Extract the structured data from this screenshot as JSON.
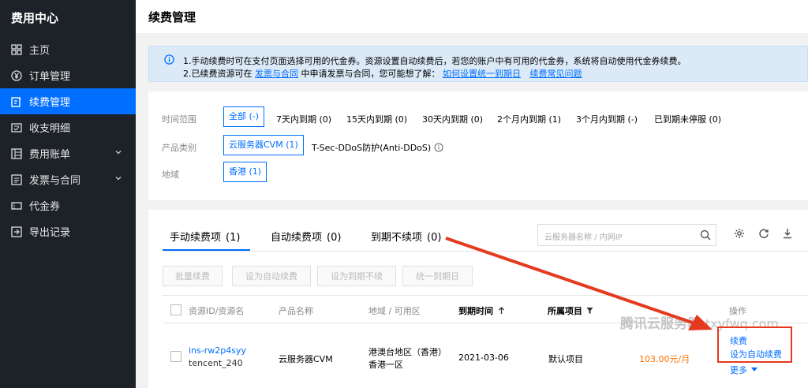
{
  "sidebar": {
    "title": "费用中心",
    "items": [
      {
        "label": "主页",
        "icon": "grid-icon"
      },
      {
        "label": "订单管理",
        "icon": "yuan-icon"
      },
      {
        "label": "续费管理",
        "icon": "renew-icon",
        "active": true
      },
      {
        "label": "收支明细",
        "icon": "ledger-icon"
      },
      {
        "label": "费用账单",
        "icon": "bill-icon",
        "expandable": true
      },
      {
        "label": "发票与合同",
        "icon": "invoice-icon",
        "expandable": true
      },
      {
        "label": "代金券",
        "icon": "voucher-icon"
      },
      {
        "label": "导出记录",
        "icon": "export-icon"
      }
    ]
  },
  "header": {
    "title": "续费管理"
  },
  "notice": {
    "line1": "1.手动续费时可在支付页面选择可用的代金券。资源设置自动续费后，若您的账户中有可用的代金券，系统将自动使用代金券续费。",
    "line2_a": "2.已续费资源可在",
    "line2_link1": "发票与合同",
    "line2_b": "中申请发票与合同，您可能想了解：",
    "line2_link2": "如何设置统一到期日",
    "line2_link3": "续费常见问题"
  },
  "filters": {
    "time_label": "时间范围",
    "time_options": [
      "全部 (-)",
      "7天内到期 (0)",
      "15天内到期 (0)",
      "30天内到期 (0)",
      "2个月内到期 (1)",
      "3个月内到期 (-)",
      "已到期未停服 (0)"
    ],
    "product_label": "产品类别",
    "product_options": [
      "云服务器CVM (1)",
      "T-Sec-DDoS防护(Anti-DDoS)"
    ],
    "region_label": "地域",
    "region_options": [
      "香港 (1)"
    ]
  },
  "tabs": [
    {
      "label": "手动续费项",
      "count": "(1)"
    },
    {
      "label": "自动续费项",
      "count": "(0)"
    },
    {
      "label": "到期不续项",
      "count": "(0)"
    }
  ],
  "search": {
    "placeholder": "云服务器名称 / 内网IP"
  },
  "batch_buttons": [
    "批量续费",
    "设为自动续费",
    "设为到期不续",
    "统一到期日"
  ],
  "table": {
    "headers": [
      "资源ID/资源名",
      "产品名称",
      "地域 / 可用区",
      "到期时间",
      "所属项目",
      "操作"
    ],
    "row": {
      "resource_id": "ins-rw2p4syy",
      "resource_name": "tencent_240",
      "product": "云服务器CVM",
      "region": "港澳台地区（香港）",
      "zone": "香港一区",
      "expire": "2021-03-06",
      "project": "默认项目",
      "price": "103.00元/月",
      "action_renew": "续费",
      "action_auto": "设为自动续费",
      "action_more": "更多"
    }
  },
  "watermark": {
    "brand": "腾讯云服务器",
    "url": "txyfwq.com"
  },
  "colors": {
    "accent": "#006eff",
    "sidebar_bg": "#1d2228",
    "price": "#ff7200",
    "annotation": "#e53a1f",
    "notice_bg": "#dceaf8"
  }
}
